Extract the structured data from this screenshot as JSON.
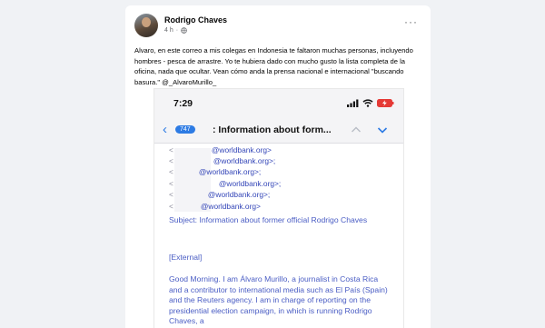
{
  "post": {
    "author": "Rodrigo Chaves",
    "time": "4 h",
    "more_label": "···",
    "text": "Alvaro, en este correo a mis colegas en Indonesia te faltaron muchas personas, incluyendo hombres - pesca de arrastre. Yo te hubiera dado con mucho gusto la lista completa de la oficina, nada que ocultar. Vean cómo anda la prensa nacional e internacional \"buscando basura.\" @_AlvaroMurillo_"
  },
  "phone": {
    "status_time": "7:29",
    "unread_count": "747",
    "back_label": "‹",
    "subject_header": ": Information about form...",
    "recipients": [
      "@worldbank.org>",
      "@worldbank.org>;",
      "@worldbank.org>;",
      "@worldbank.org>;",
      "@worldbank.org>;",
      "@worldbank.org>"
    ],
    "subject_line": "Subject: Information about former official Rodrigo Chaves",
    "external_tag": "[External]",
    "body": "Good Morning. I am Álvaro Murillo, a journalist in Costa Rica and a contributor to international media such as El País (Spain) and the Reuters agency. I am in charge of reporting on the presidential election campaign, in which is running Rodrigo Chaves, a"
  },
  "icons": {
    "globe": "globe-icon",
    "more": "more-options-icon",
    "signal": "signal-icon",
    "wifi": "wifi-icon",
    "battery": "battery-charging-icon",
    "back": "back-chevron-icon",
    "up": "chevron-up-icon",
    "down": "chevron-down-icon"
  },
  "colors": {
    "link_blue": "#2d7be4",
    "email_text": "#4a5dc4",
    "battery_red": "#e53935"
  }
}
